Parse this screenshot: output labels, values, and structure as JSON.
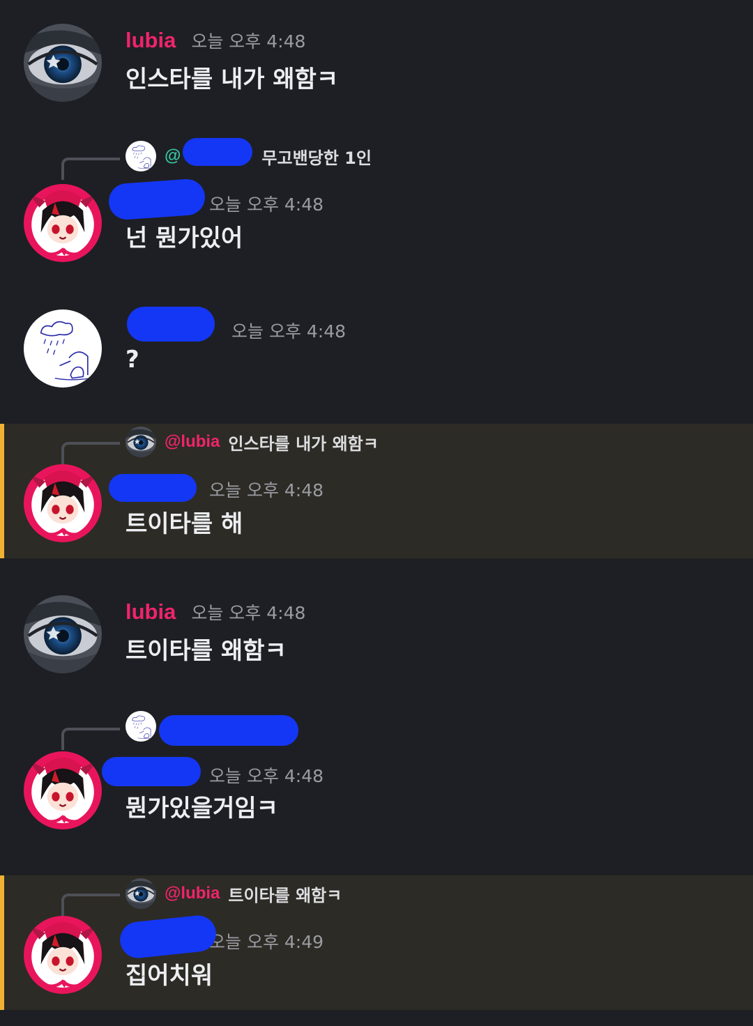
{
  "messages": [
    {
      "author": "lubia",
      "time": "오늘 오후 4:48",
      "text": "인스타를 내가 왜함ㅋ"
    },
    {
      "reply_prefix": "@",
      "reply_text": "무고밴당한 1인",
      "time": "오늘 오후 4:48",
      "text": "넌 뭔가있어"
    },
    {
      "time": "오늘 오후 4:48",
      "text": "?"
    },
    {
      "reply_mention": "@lubia",
      "reply_text": "인스타를 내가 왜함ㅋ",
      "time": "오늘 오후 4:48",
      "text": "트이타를 해"
    },
    {
      "author": "lubia",
      "time": "오늘 오후 4:48",
      "text": "트이타를 왜함ㅋ"
    },
    {
      "time": "오늘 오후 4:48",
      "text": "뭔가있을거임ㅋ"
    },
    {
      "reply_mention": "@lubia",
      "reply_text": "트이타를 왜함ㅋ",
      "time": "오늘 오후 4:49",
      "text": "집어치워"
    }
  ],
  "colors": {
    "background": "#1e1f24",
    "highlight": "#2d2b25",
    "highlight_bar": "#f0b232",
    "username": "#f0246b",
    "mention_teal": "#35c5a1",
    "redaction": "#1437f5"
  },
  "icons": {
    "lubia_avatar": "eye-avatar-icon",
    "devil_avatar": "devil-girl-avatar-icon",
    "doodle_avatar": "rain-doodle-avatar-icon"
  }
}
